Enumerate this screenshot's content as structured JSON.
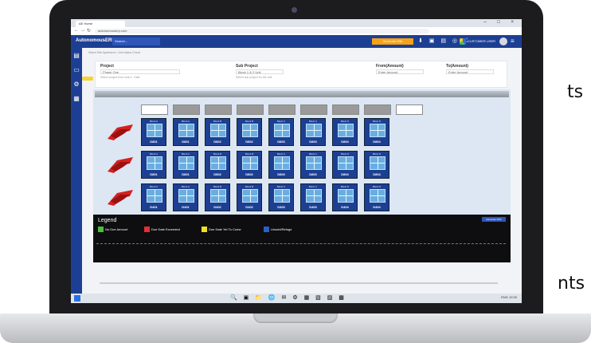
{
  "side_text": [
    "ts",
    "nts"
  ],
  "browser": {
    "tab_title": "AE Home",
    "url": "autonomouserp.com",
    "controls": "– □ ×"
  },
  "app": {
    "brand": "AutonomousERP",
    "menu_tab": "Search...",
    "header_button": "Generate Bills",
    "header_icons": "⬇ ▣ ▤ ◎ ⛶",
    "user_name": "CUSTOMER USER",
    "breadcrumb": "Select Site Apartment > Unit status Check"
  },
  "form": {
    "project_label": "Project",
    "project_value": "Phase One",
    "project_hint": "Select project from Unit # : Date",
    "sub_project_label": "Sub Project",
    "sub_project_value": "Block 1 & 2 Unit",
    "sub_project_hint": "Select sub project for the unit",
    "from_label": "From(Amount)",
    "from_value": "Enter Amount",
    "to_label": "To(Amount)",
    "to_value": "Enter Amount"
  },
  "rows": [
    {
      "units": [
        {
          "block": "Block A",
          "code": "D801",
          "color": "#1d3f93"
        },
        {
          "block": "Block A",
          "code": "D801",
          "color": "#1d3f93"
        },
        {
          "block": "Block B",
          "code": "D802",
          "color": "#1d3f93"
        },
        {
          "block": "Block B",
          "code": "D802",
          "color": "#1d3f93"
        },
        {
          "block": "Block C",
          "code": "D803",
          "color": "#1d3f93"
        },
        {
          "block": "Block C",
          "code": "D803",
          "color": "#1d3f93"
        },
        {
          "block": "Block D",
          "code": "D804",
          "color": "#1d3f93"
        },
        {
          "block": "Block D",
          "code": "D804",
          "color": "#1d3f93"
        }
      ]
    },
    {
      "units": [
        {
          "block": "Block A",
          "code": "D801",
          "color": "#1d3f93"
        },
        {
          "block": "Block A",
          "code": "D801",
          "color": "#1d3f93"
        },
        {
          "block": "Block B",
          "code": "D802",
          "color": "#1d3f93"
        },
        {
          "block": "Block B",
          "code": "D802",
          "color": "#1d3f93"
        },
        {
          "block": "Block C",
          "code": "D803",
          "color": "#1d3f93"
        },
        {
          "block": "Block C",
          "code": "D803",
          "color": "#1d3f93"
        },
        {
          "block": "Block D",
          "code": "D804",
          "color": "#1d3f93"
        },
        {
          "block": "Block D",
          "code": "D804",
          "color": "#1d3f93"
        }
      ]
    },
    {
      "units": [
        {
          "block": "Block A",
          "code": "D401",
          "color": "#1d3f93"
        },
        {
          "block": "Block A",
          "code": "D401",
          "color": "#1d3f93"
        },
        {
          "block": "Block B",
          "code": "D402",
          "color": "#1d3f93"
        },
        {
          "block": "Block B",
          "code": "D402",
          "color": "#1d3f93"
        },
        {
          "block": "Block C",
          "code": "D403",
          "color": "#1d3f93"
        },
        {
          "block": "Block C",
          "code": "D403",
          "color": "#1d3f93"
        },
        {
          "block": "Block D",
          "code": "D404",
          "color": "#1d3f93"
        },
        {
          "block": "Block D",
          "code": "D404",
          "color": "#1d3f93"
        }
      ]
    }
  ],
  "legend": {
    "title": "Legend",
    "button": "Generate PDF",
    "items": [
      {
        "label": "No Due Amount",
        "color": "#4bbf3a"
      },
      {
        "label": "Due Date Exceeded",
        "color": "#e23030"
      },
      {
        "label": "Due Date Yet To Come",
        "color": "#f0e020"
      },
      {
        "label": "Unsold/Refuge",
        "color": "#2c5fc4"
      }
    ]
  },
  "taskbar": {
    "icons": "🔍 ▣ 📁 🌐 ✉ ⚙ ▦ ▧ ▨ ▩",
    "time": "ENG 12:00"
  }
}
